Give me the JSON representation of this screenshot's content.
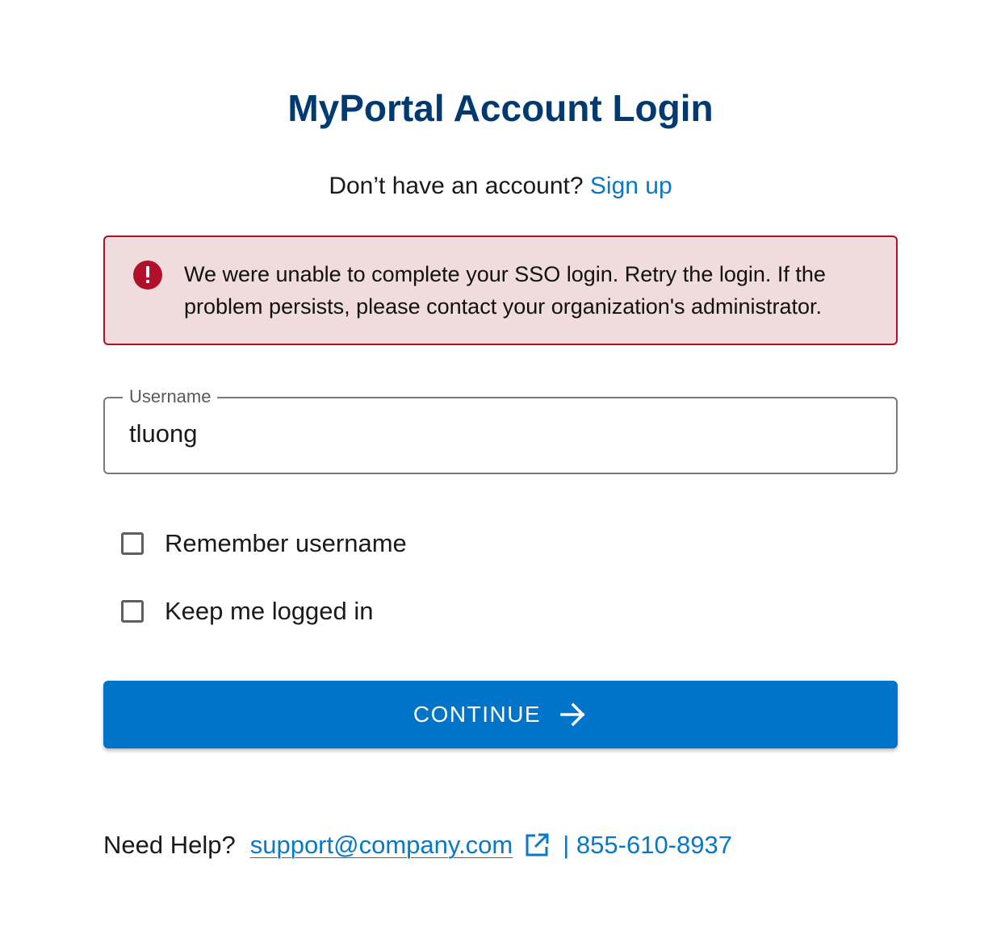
{
  "page": {
    "title": "MyPortal Account Login"
  },
  "signup": {
    "prompt": "Don’t have an account?",
    "link_label": "Sign up"
  },
  "alert": {
    "icon": "error-icon",
    "message": "We were unable to complete your SSO login. Retry the login. If the problem persists, please contact your organization's administrator.",
    "color": "#b0102a",
    "background": "#f0dcdc"
  },
  "username": {
    "label": "Username",
    "value": "tluong"
  },
  "options": {
    "remember_label": "Remember username",
    "remember_checked": false,
    "keep_logged_label": "Keep me logged in",
    "keep_logged_checked": false
  },
  "continue_button": {
    "label": "CONTINUE",
    "icon": "arrow-right-icon",
    "color": "#0074c8"
  },
  "help": {
    "label": "Need Help?",
    "email": "support@company.com",
    "email_icon": "external-link-icon",
    "phone": "| 855-610-8937"
  },
  "colors": {
    "title": "#003a70",
    "link": "#0a78c8"
  }
}
